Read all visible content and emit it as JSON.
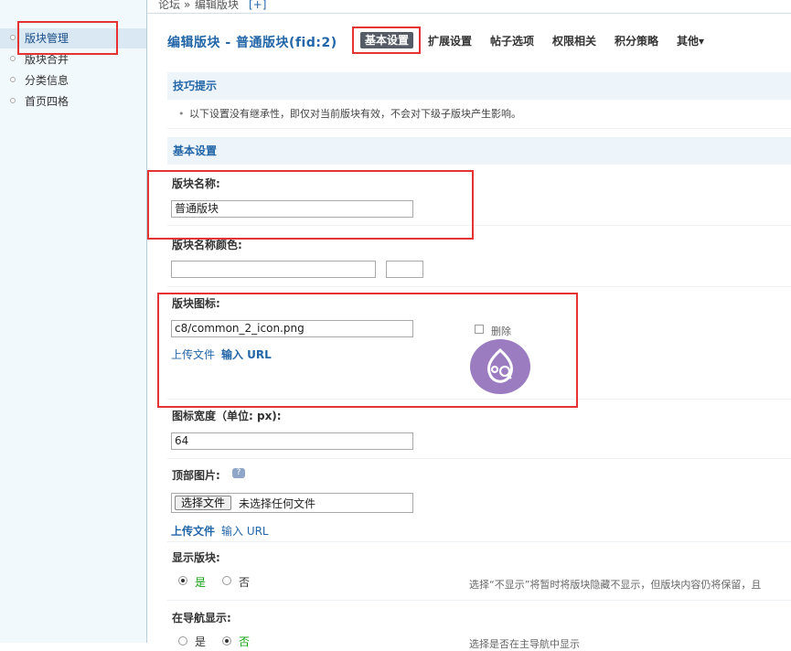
{
  "breadcrumb": {
    "root": "论坛",
    "separator": "»",
    "current": "编辑版块",
    "plus": "[+]"
  },
  "sidebar": {
    "items": [
      {
        "label": "版块管理",
        "active": true
      },
      {
        "label": "版块合并",
        "active": false
      },
      {
        "label": "分类信息",
        "active": false
      },
      {
        "label": "首页四格",
        "active": false
      }
    ]
  },
  "header": {
    "title": "编辑版块 - 普通版块(fid:2)",
    "tabs": [
      {
        "label": "基本设置",
        "active": true
      },
      {
        "label": "扩展设置",
        "active": false
      },
      {
        "label": "帖子选项",
        "active": false
      },
      {
        "label": "权限相关",
        "active": false
      },
      {
        "label": "积分策略",
        "active": false
      },
      {
        "label": "其他▾",
        "active": false
      }
    ]
  },
  "tips": {
    "heading": "技巧提示",
    "bullet": "•",
    "text": "以下设置没有继承性，即仅对当前版块有效，不会对下级子版块产生影响。"
  },
  "basic": {
    "heading": "基本设置",
    "name_label": "版块名称:",
    "name_value": "普通版块",
    "name_color_label": "版块名称颜色:",
    "name_color_value": "",
    "icon_label": "版块图标:",
    "icon_value": "c8/common_2_icon.png",
    "icon_upload": "上传文件",
    "icon_url": "输入 URL",
    "icon_delete": "删除",
    "icon_image": "forum-icon",
    "width_label": "图标宽度（单位: px):",
    "width_value": "64",
    "banner_label": "顶部图片:",
    "banner_help": "?",
    "file_button": "选择文件",
    "file_status": "未选择任何文件",
    "banner_upload": "上传文件",
    "banner_url": "输入 URL",
    "display_label": "显示版块:",
    "display_yes": "是",
    "display_no": "否",
    "display_note": "选择“不显示”将暂时将版块隐藏不显示，但版块内容仍将保留，且",
    "nav_label": "在导航显示:",
    "nav_yes": "是",
    "nav_no": "否",
    "nav_note": "选择是否在主导航中显示"
  },
  "colors": {
    "accent": "#2366a8",
    "active_tab_bg": "#555c66",
    "annotation": "#e53333",
    "yes_green": "#12a012",
    "icon_purple": "#9b7cc0"
  }
}
